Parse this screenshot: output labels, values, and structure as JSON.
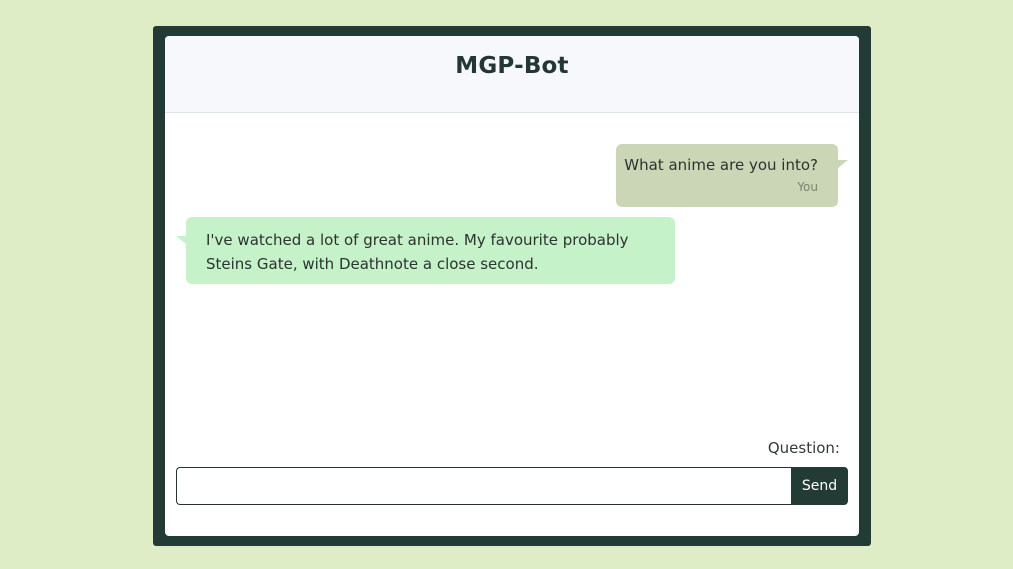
{
  "header": {
    "title": "MGP-Bot"
  },
  "messages": [
    {
      "role": "user",
      "text": "What anime are you into?",
      "sender": "You"
    },
    {
      "role": "bot",
      "text": "I've watched a lot of great anime. My favourite probably Steins Gate, with Deathnote a close second."
    }
  ],
  "composer": {
    "label": "Question:",
    "value": "",
    "send_label": "Send"
  },
  "colors": {
    "page_background": "#dfedc6",
    "frame": "#233b35",
    "user_bubble": "#cbd6b6",
    "bot_bubble": "#c5f2c8",
    "send_button": "#233b35"
  }
}
